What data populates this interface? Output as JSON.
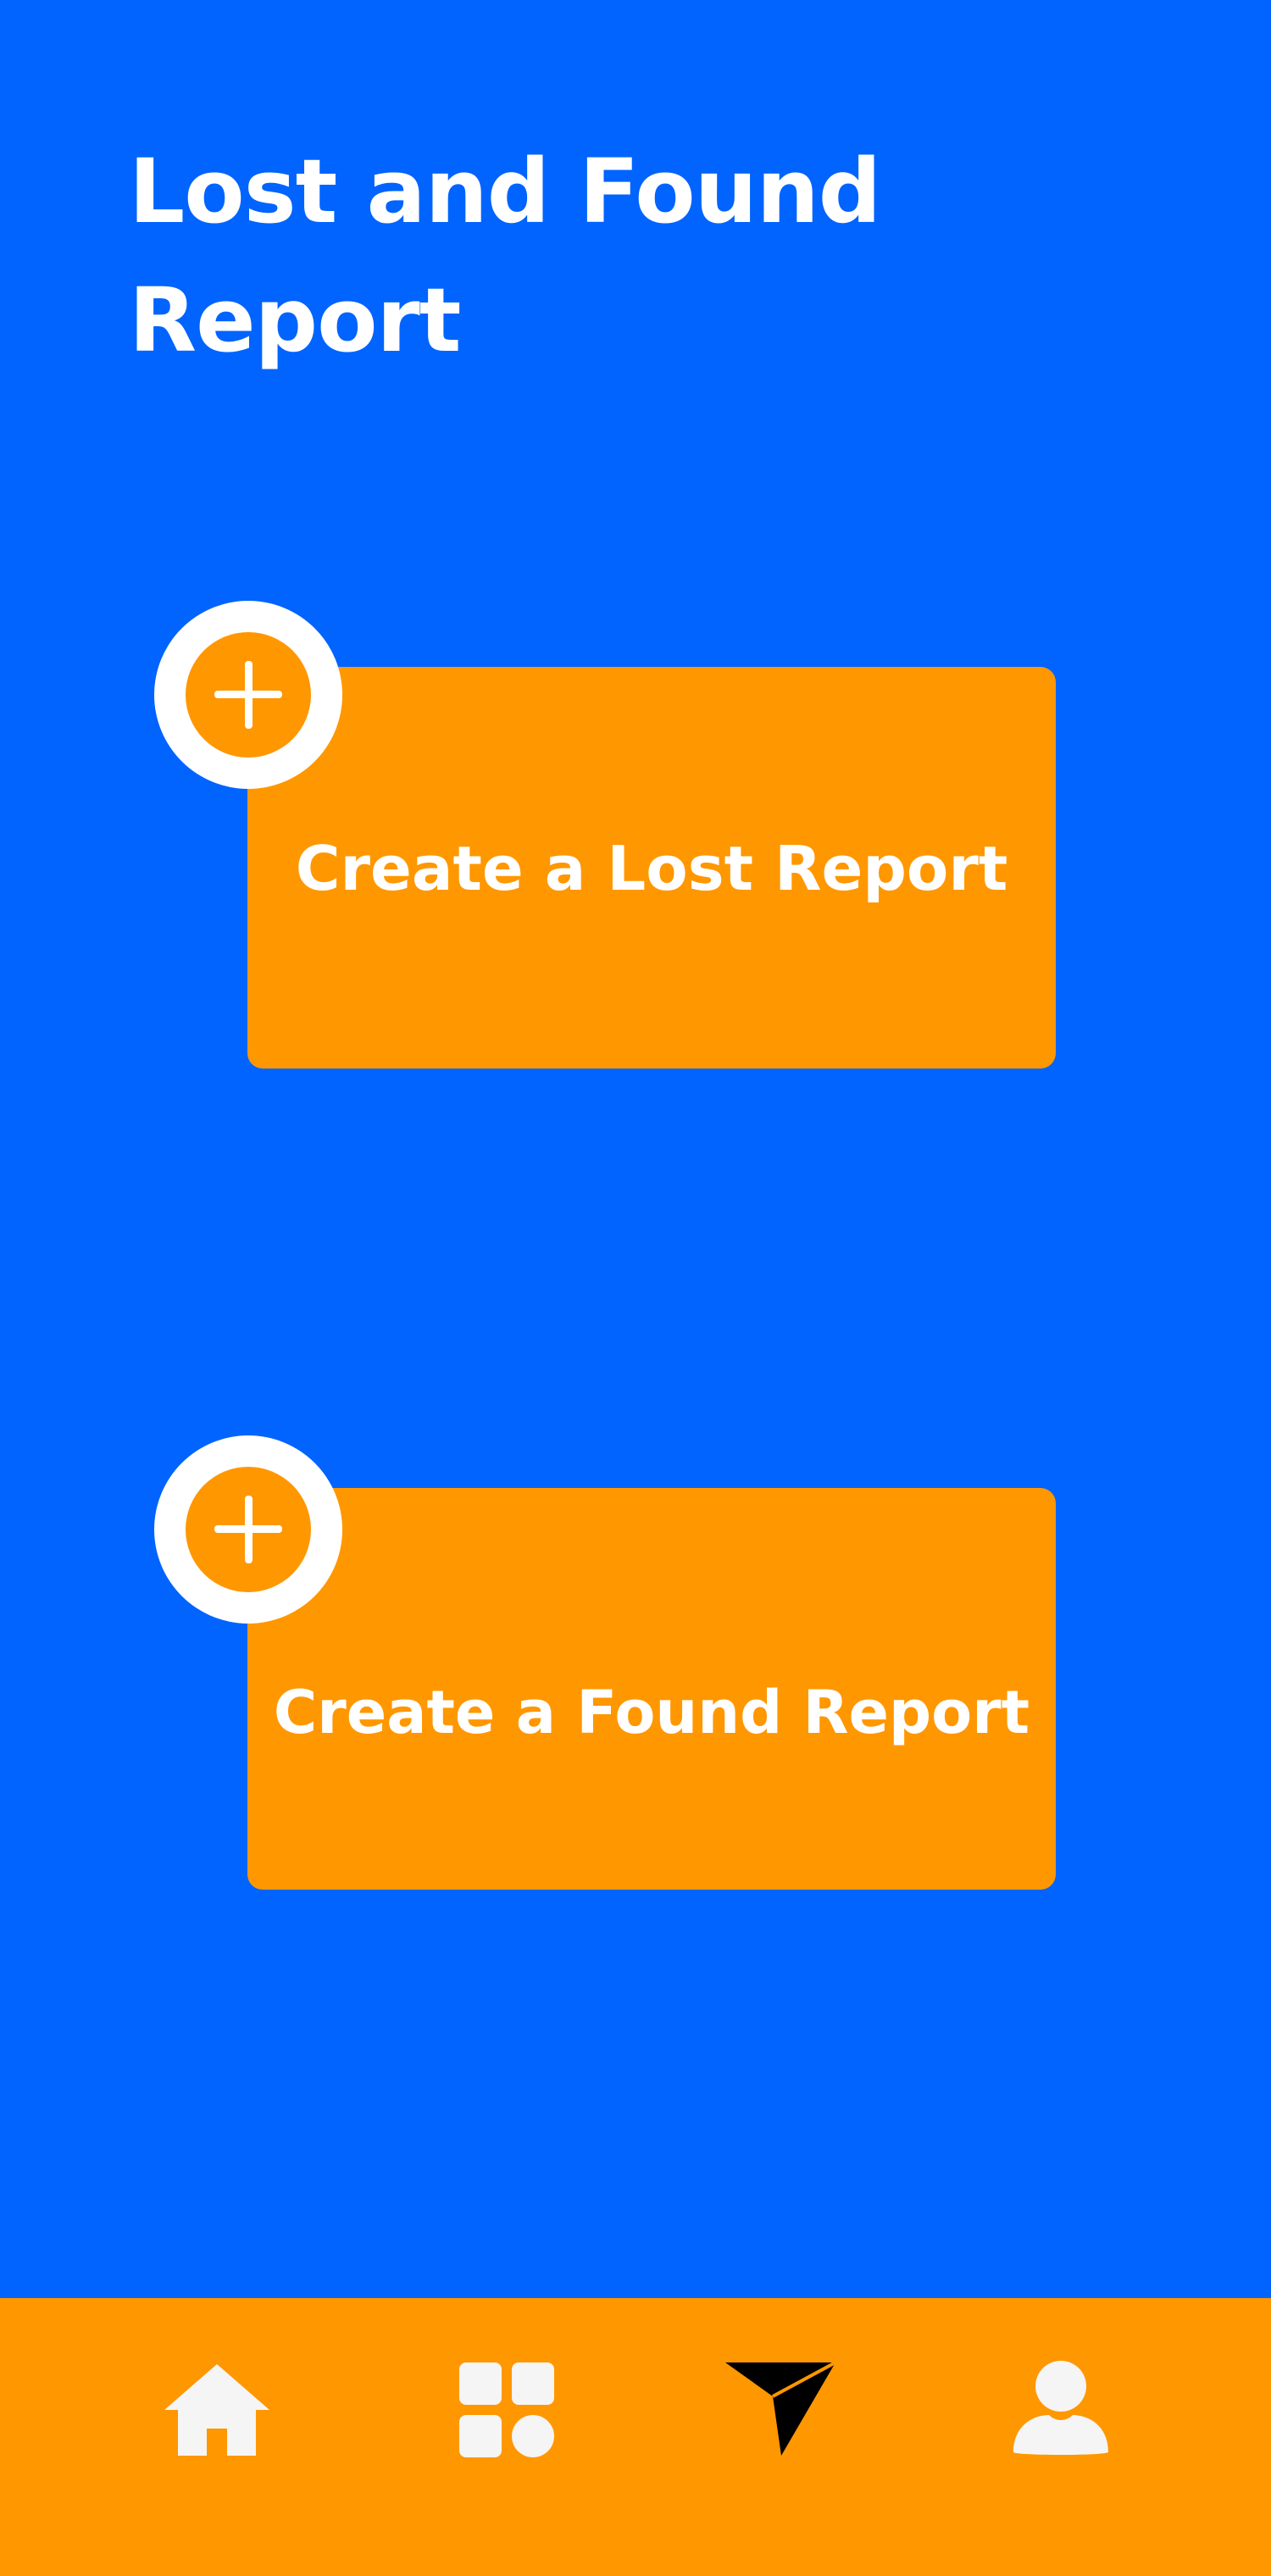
{
  "header": {
    "title": "Lost and Found Report"
  },
  "actions": {
    "lost_report_label": "Create a Lost Report",
    "found_report_label": "Create a Found Report"
  },
  "icons": {
    "add": "plus-circle-icon",
    "nav": [
      "home-icon",
      "grid-icon",
      "send-icon",
      "user-icon"
    ]
  },
  "colors": {
    "background": "#0164FE",
    "accent": "#FF9700",
    "text": "#FFFFFF",
    "icon_light": "#F5F5F5",
    "icon_active": "#000000"
  }
}
